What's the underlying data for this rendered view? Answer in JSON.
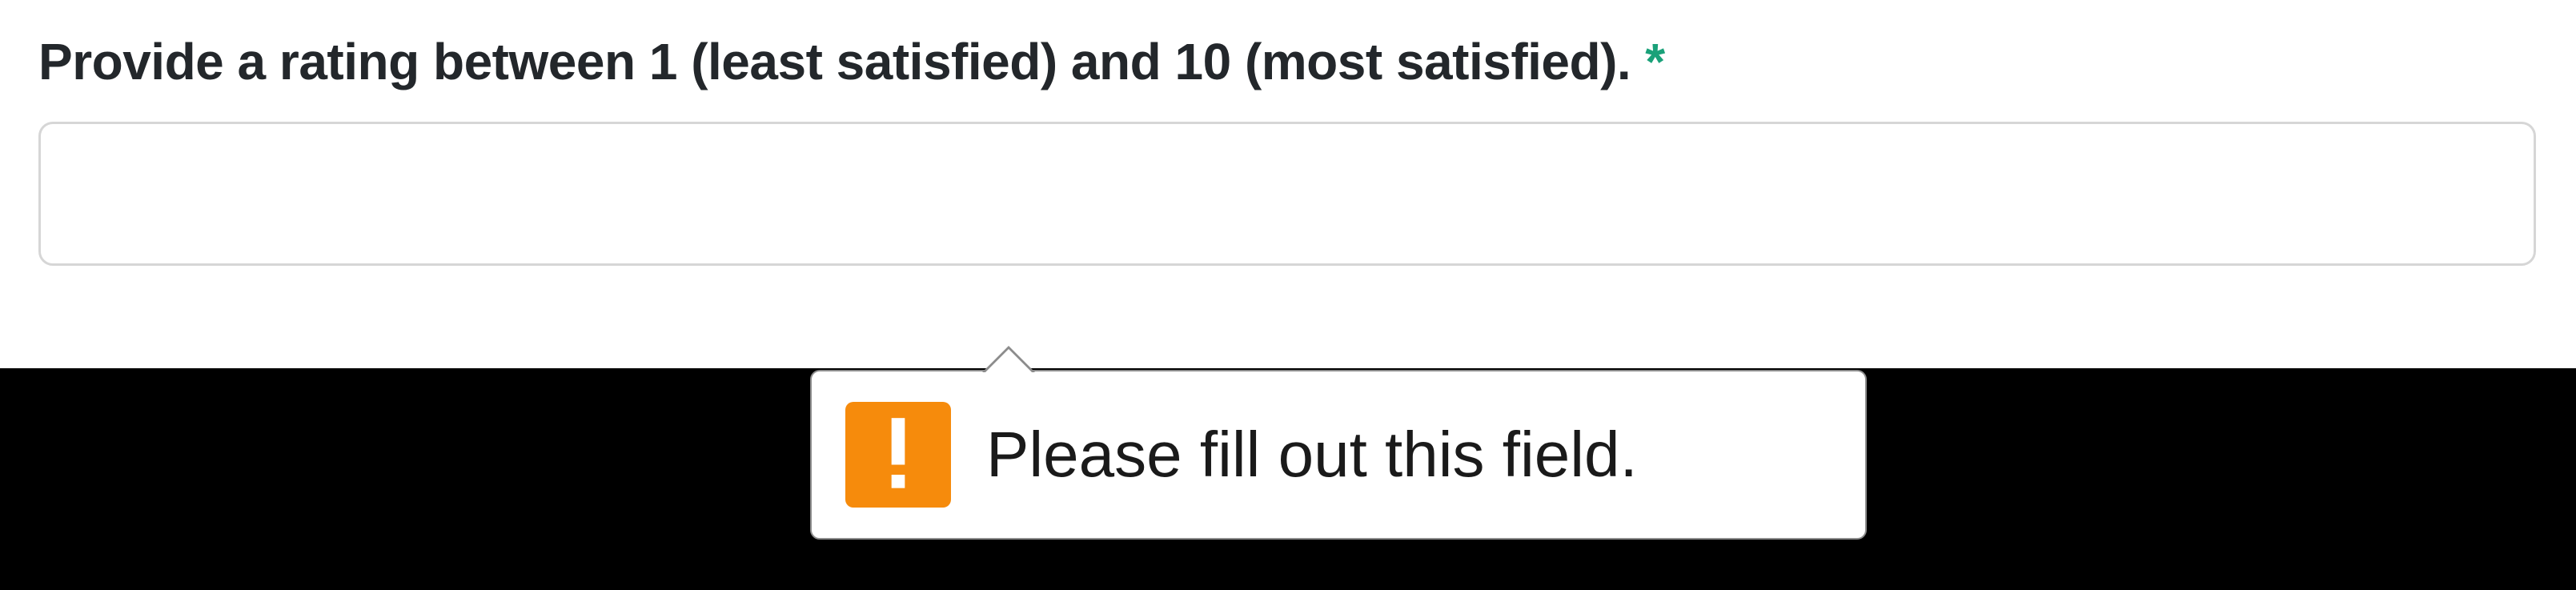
{
  "form": {
    "label": "Provide a rating between 1 (least satisfied) and 10 (most satisfied).",
    "required_mark": "*",
    "input_value": ""
  },
  "tooltip": {
    "message": "Please fill out this field.",
    "icon": "exclamation-icon"
  }
}
